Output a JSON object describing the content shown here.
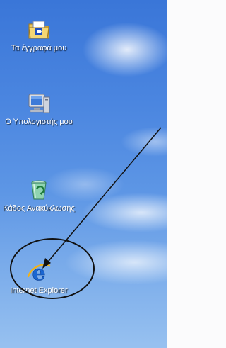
{
  "desktop": {
    "icons": [
      {
        "label": "Τα έγγραφά μου",
        "icon": "my-documents-icon"
      },
      {
        "label": "Ο Υπολογιστής μου",
        "icon": "my-computer-icon"
      },
      {
        "label": "Κάδος Ανακύκλωσης",
        "icon": "recycle-bin-icon"
      },
      {
        "label": "Internet Explorer",
        "icon": "internet-explorer-icon"
      }
    ]
  },
  "colors": {
    "desktop_sky_top": "#3a76d8",
    "desktop_sky_bottom": "#97c1f0",
    "label_text": "#ffffff",
    "annotation": "#111111"
  }
}
